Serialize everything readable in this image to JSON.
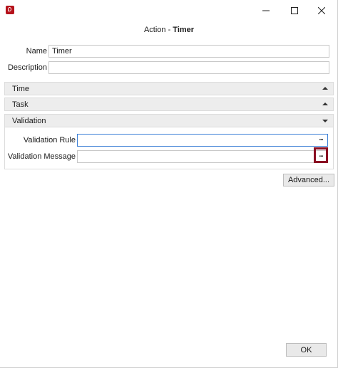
{
  "dialog": {
    "title_prefix": "Action - ",
    "title_name": "Timer"
  },
  "fields": {
    "name_label": "Name",
    "name_value": "Timer",
    "description_label": "Description",
    "description_value": ""
  },
  "sections": [
    {
      "label": "Time",
      "state": "collapsed"
    },
    {
      "label": "Task",
      "state": "collapsed"
    },
    {
      "label": "Validation",
      "state": "expanded"
    }
  ],
  "validation": {
    "rule_label": "Validation Rule",
    "rule_value": "",
    "message_label": "Validation Message",
    "message_value": "",
    "ellipsis": "..."
  },
  "buttons": {
    "advanced": "Advanced...",
    "ok": "OK"
  },
  "colors": {
    "highlight": "#8a0f22",
    "focus_border": "#3c7fd6",
    "app_icon": "#b5121b"
  }
}
